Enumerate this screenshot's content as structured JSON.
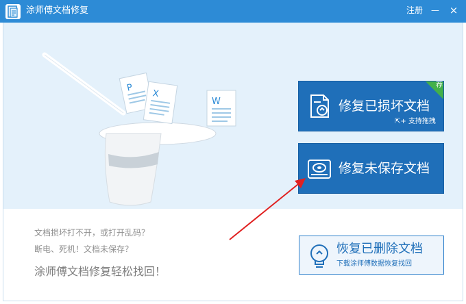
{
  "window": {
    "title": "涂师傅文档修复",
    "register_label": "注册",
    "minimize_glyph": "—",
    "close_glyph": "×"
  },
  "actions": {
    "repair_damaged": {
      "label": "修复已损坏文档",
      "sub_label": "支持拖拽",
      "badge": "荐",
      "icon": "damaged-document-icon"
    },
    "repair_unsaved": {
      "label": "修复未保存文档",
      "icon": "disk-icon"
    },
    "recover_deleted": {
      "label": "恢复已删除文档",
      "sub_label": "下载涂师傅数据恢复找回",
      "icon": "lightbulb-icon"
    }
  },
  "taglines": {
    "line1": "文档损坏打不开，或打开乱码？",
    "line2": "断电、死机！文档未保存？",
    "line3": "涂师傅文档修复轻松找回！"
  },
  "illustration": {
    "icon": "magic-hat-documents-illustration",
    "doc_letters": [
      "P",
      "X",
      "W"
    ]
  },
  "annotation": {
    "icon": "red-arrow-icon",
    "color": "#e02020"
  },
  "colors": {
    "titlebar": "#2d8bd6",
    "primary_button": "#1f6fb9",
    "hero_background": "#e4f1fb",
    "badge": "#43b04a"
  }
}
